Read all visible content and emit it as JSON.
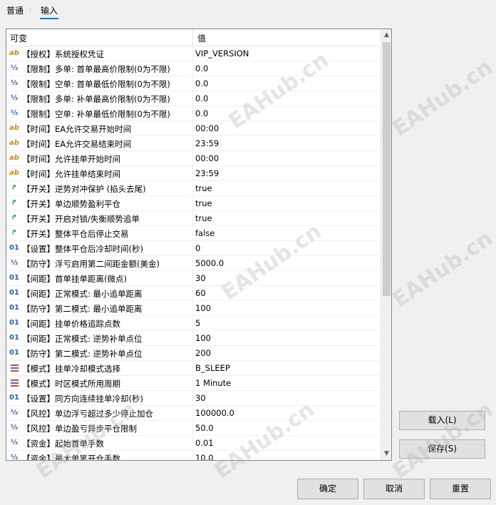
{
  "tabs": [
    {
      "label": "普通"
    },
    {
      "label": "输入"
    }
  ],
  "table": {
    "col_name": "可变",
    "col_value": "值",
    "rows": [
      {
        "icon": "ab",
        "name": "【授权】系统授权凭证",
        "value": "VIP_VERSION"
      },
      {
        "icon": "half",
        "name": "【限制】多单: 首单最高价限制(0为不限)",
        "value": "0.0"
      },
      {
        "icon": "half",
        "name": "【限制】空单: 首单最低价限制(0为不限)",
        "value": "0.0"
      },
      {
        "icon": "half",
        "name": "【限制】多单: 补单最高价限制(0为不限)",
        "value": "0.0"
      },
      {
        "icon": "half",
        "name": "【限制】空单: 补单最低价限制(0为不限)",
        "value": "0.0"
      },
      {
        "icon": "ab",
        "name": "【时间】EA允许交易开始时间",
        "value": "00:00"
      },
      {
        "icon": "ab",
        "name": "【时间】EA允许交易结束时间",
        "value": "23:59"
      },
      {
        "icon": "ab",
        "name": "【时间】允许挂单开始时间",
        "value": "00:00"
      },
      {
        "icon": "ab",
        "name": "【时间】允许挂单结束时间",
        "value": "23:59"
      },
      {
        "icon": "switch",
        "name": "【开关】逆势对冲保护 (掐头去尾)",
        "value": "true"
      },
      {
        "icon": "switch",
        "name": "【开关】单边顺势盈利平仓",
        "value": "true"
      },
      {
        "icon": "switch",
        "name": "【开关】开启对锁/失衡顺势追单",
        "value": "true"
      },
      {
        "icon": "switch",
        "name": "【开关】整体平仓后停止交易",
        "value": "false"
      },
      {
        "icon": "01",
        "name": "【设置】整体平仓后冷却时间(秒)",
        "value": "0"
      },
      {
        "icon": "half",
        "name": "【防守】浮亏启用第二间距金额(美金)",
        "value": "5000.0"
      },
      {
        "icon": "01",
        "name": "【间距】首单挂单距离(微点)",
        "value": "30"
      },
      {
        "icon": "01",
        "name": "【间距】正常模式: 最小追单距离",
        "value": "60"
      },
      {
        "icon": "01",
        "name": "【防守】第二模式: 最小追单距离",
        "value": "100"
      },
      {
        "icon": "01",
        "name": "【间距】挂单价格追踪点数",
        "value": "5"
      },
      {
        "icon": "01",
        "name": "【间距】正常模式: 逆势补单点位",
        "value": "100"
      },
      {
        "icon": "01",
        "name": "【防守】第二模式: 逆势补单点位",
        "value": "200"
      },
      {
        "icon": "enum",
        "name": "【模式】挂单冷却模式选择",
        "value": "B_SLEEP"
      },
      {
        "icon": "enum",
        "name": "【模式】时区模式所用周期",
        "value": "1 Minute"
      },
      {
        "icon": "01",
        "name": "【设置】同方向连续挂单冷却(秒)",
        "value": "30"
      },
      {
        "icon": "half",
        "name": "【风控】单边浮亏超过多少停止加仓",
        "value": "100000.0"
      },
      {
        "icon": "half",
        "name": "【风控】单边盈亏异步平仓限制",
        "value": "50.0"
      },
      {
        "icon": "half",
        "name": "【资金】起始首单手数",
        "value": "0.01"
      },
      {
        "icon": "half",
        "name": "【资金】最大单笔开仓手数",
        "value": "10.0"
      }
    ]
  },
  "icons": {
    "ab": "ab",
    "half": "½",
    "01": "01",
    "switch": "↱",
    "up": "▲",
    "down": "▼"
  },
  "buttons": {
    "load": "载入(L)",
    "save": "保存(S)",
    "ok": "确定",
    "cancel": "取消",
    "reset": "重置"
  },
  "watermark": "EAHub.cn"
}
